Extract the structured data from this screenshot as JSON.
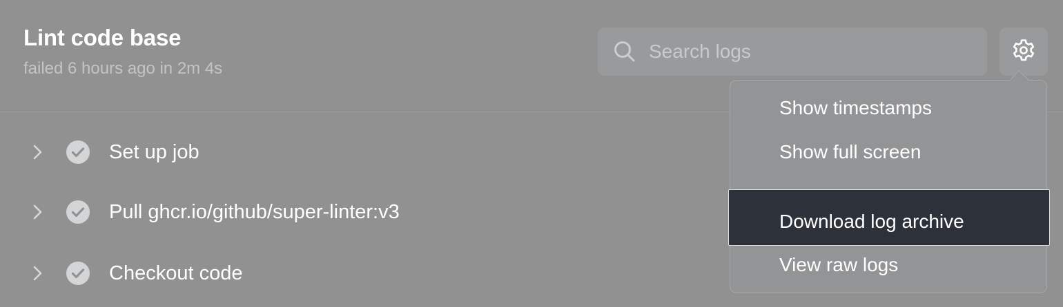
{
  "job": {
    "title": "Lint code base",
    "status": "failed 6 hours ago in 2m 4s"
  },
  "search": {
    "placeholder": "Search logs",
    "value": ""
  },
  "steps": [
    {
      "label": "Set up job",
      "status": "success"
    },
    {
      "label": "Pull ghcr.io/github/super-linter:v3",
      "status": "success"
    },
    {
      "label": "Checkout code",
      "status": "success"
    }
  ],
  "settings_menu": {
    "items": [
      {
        "label": "Show timestamps"
      },
      {
        "label": "Show full screen"
      },
      {
        "label": "Download log archive",
        "highlighted": true
      },
      {
        "label": "View raw logs"
      }
    ]
  },
  "icons": {
    "search": "search-icon",
    "settings": "gear-icon",
    "expand": "chevron-right-icon",
    "step_status": "check-circle-icon"
  },
  "colors": {
    "overlay_background": "#919192",
    "highlight_background": "#2d3139",
    "check_circle": "#d4d5d7"
  }
}
